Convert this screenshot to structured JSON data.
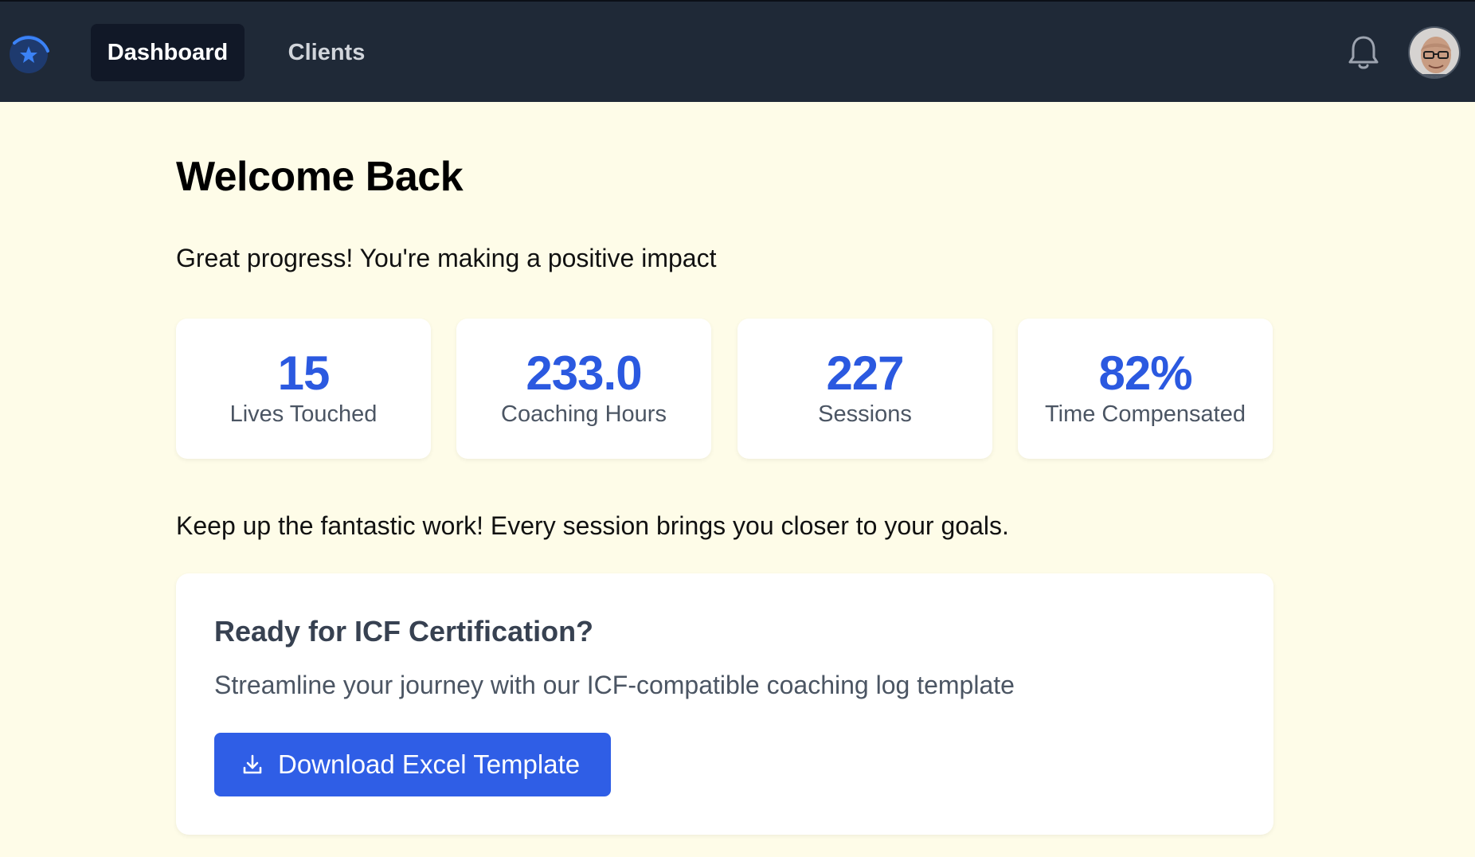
{
  "nav": {
    "logo_icon": "star-circle-logo",
    "items": [
      {
        "label": "Dashboard",
        "active": true
      },
      {
        "label": "Clients",
        "active": false
      }
    ],
    "notification_icon": "bell-icon",
    "avatar_icon": "user-avatar"
  },
  "main": {
    "title": "Welcome Back",
    "subtitle": "Great progress! You're making a positive impact",
    "stats": [
      {
        "value": "15",
        "label": "Lives Touched"
      },
      {
        "value": "233.0",
        "label": "Coaching Hours"
      },
      {
        "value": "227",
        "label": "Sessions"
      },
      {
        "value": "82%",
        "label": "Time Compensated"
      }
    ],
    "encouragement": "Keep up the fantastic work! Every session brings you closer to your goals.",
    "certification": {
      "title": "Ready for ICF Certification?",
      "description": "Streamline your journey with our ICF-compatible coaching log template",
      "button_label": "Download Excel Template",
      "button_icon": "download-icon"
    }
  },
  "colors": {
    "topbar": "#1f2937",
    "page_background": "#fefce8",
    "accent": "#2b59e0",
    "button": "#2f5ee6"
  }
}
